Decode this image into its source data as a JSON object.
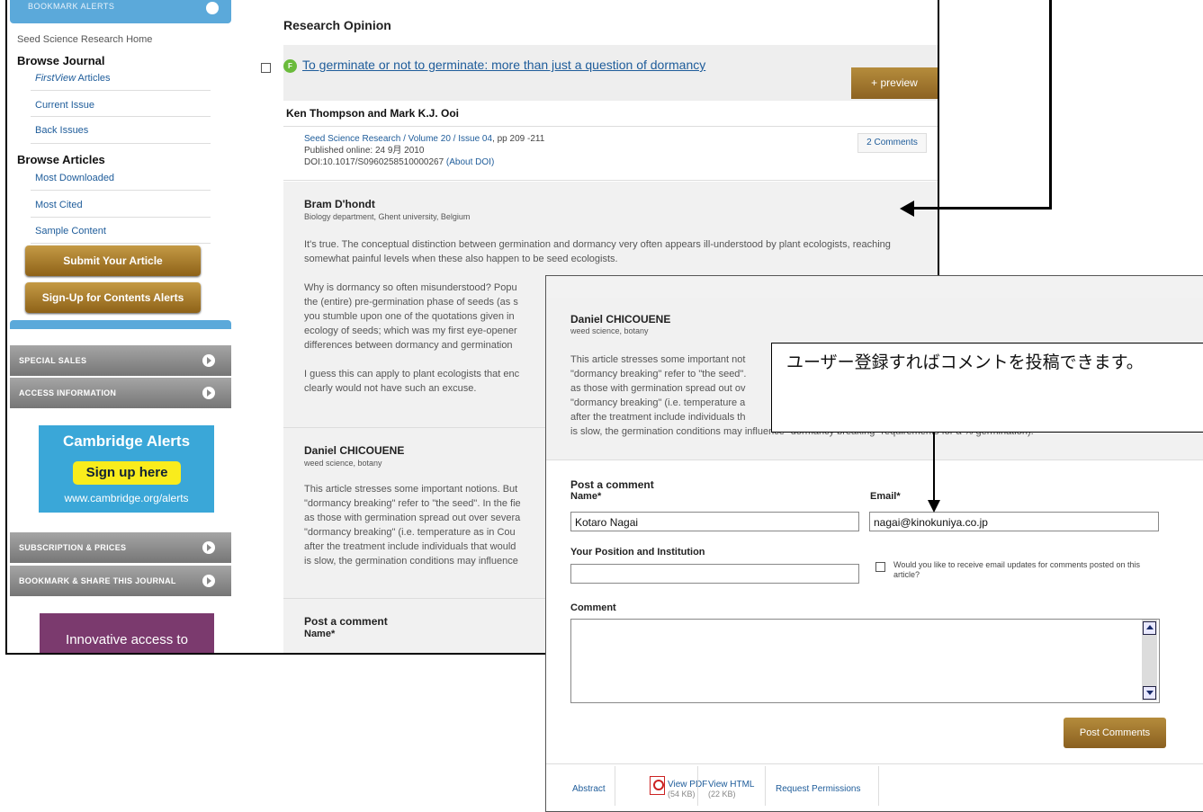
{
  "sidebar": {
    "top_label": "BOOKMARK ALERTS",
    "home_link": "Seed Science Research Home",
    "browse_journal_heading": "Browse Journal",
    "firstview_prefix": "FirstView",
    "firstview_suffix": " Articles",
    "current_issue": "Current Issue",
    "back_issues": "Back Issues",
    "browse_articles_heading": "Browse Articles",
    "most_downloaded": "Most Downloaded",
    "most_cited": "Most Cited",
    "sample_content": "Sample Content",
    "submit_button": "Submit Your Article",
    "signup_button": "Sign-Up for Contents Alerts",
    "special_sales": "SPECIAL SALES",
    "access_information": "ACCESS INFORMATION",
    "cambridge_alerts_title": "Cambridge Alerts",
    "cambridge_alerts_button": "Sign up here",
    "cambridge_alerts_url": "www.cambridge.org/alerts",
    "subscription_prices": "SUBSCRIPTION & PRICES",
    "bookmark_share": "BOOKMARK & SHARE THIS JOURNAL",
    "innovative_banner": "Innovative access to"
  },
  "main": {
    "section_title": "Research Opinion",
    "article": {
      "badge": "F",
      "title": "To germinate or not to germinate: more than just a question of dormancy",
      "preview_button": "+ preview",
      "authors": "Ken Thompson and Mark K.J. Ooi",
      "journal_link": "Seed Science Research",
      "volume_link": "Volume 20",
      "issue_link": "Issue 04",
      "sep1": " / ",
      "sep2": " / ",
      "pages": ", pp 209 -211",
      "published": "Published online: 24 9月 2010",
      "doi": "DOI:10.1017/S0960258510000267",
      "about_doi": "(About DOI)",
      "comments_link": "2 Comments"
    },
    "comments": [
      {
        "name": "Bram D'hondt",
        "affiliation": "Biology department, Ghent university, Belgium",
        "p1": "It's true. The conceptual distinction between germination and dormancy very often appears ill-understood by plant ecologists, reaching somewhat painful levels when these also happen to be seed ecologists.",
        "p2_lines": [
          "Why is dormancy so often misunderstood? Popu",
          "the (entire) pre-germination phase of seeds (as s",
          "you stumble upon one of the quotations given in",
          "ecology of seeds; which was my first eye-opener",
          "differences between dormancy and germination"
        ],
        "p3_lines": [
          "I guess this can apply to plant ecologists that enc",
          "clearly would not have such an excuse."
        ]
      },
      {
        "name": "Daniel CHICOUENE",
        "affiliation": "weed science, botany",
        "lines": [
          "This article stresses some important notions. But",
          "\"dormancy breaking\" refer to \"the seed\". In the fie",
          "as those with germination spread out over severa",
          "\"dormancy breaking\" (i.e. temperature as in Cou",
          "after the treatment include individuals that would",
          "is slow, the germination conditions may influence"
        ]
      }
    ],
    "post_comment_heading": "Post a comment",
    "name_label": "Name*"
  },
  "front_window": {
    "comment": {
      "name": "Daniel CHICOUENE",
      "affiliation": "weed science, botany",
      "lines": [
        "This article stresses some important not",
        "\"dormancy breaking\" refer to \"the seed\".",
        "as those with germination spread out ov",
        "\"dormancy breaking\" (i.e. temperature a",
        "after the treatment include individuals th",
        "is slow, the germination conditions may influence \"dormancy breaking\" requirements for a % germination)."
      ]
    },
    "form": {
      "heading": "Post a comment",
      "name_label": "Name*",
      "name_value": "Kotaro Nagai",
      "email_label": "Email*",
      "email_value": "nagai@kinokuniya.co.jp",
      "position_label": "Your Position and Institution",
      "position_value": "",
      "email_updates_label": "Would you like to receive email updates for comments posted on this article?",
      "comment_label": "Comment",
      "post_button": "Post Comments"
    },
    "tabs": {
      "abstract": "Abstract",
      "view_pdf": "View PDF",
      "pdf_size": "(54 KB)",
      "view_html": "View HTML",
      "html_size": "(22 KB)",
      "request_permissions": "Request Permissions"
    }
  },
  "callout": {
    "text": "ユーザー登録すればコメントを投稿できます。"
  },
  "colors": {
    "link": "#1e5c9a",
    "gold_button": "#a57a30",
    "sidebar_blue": "#5ba9da",
    "cambridge_blue": "#3aa7d8",
    "cambridge_yellow": "#f9ec1c"
  }
}
